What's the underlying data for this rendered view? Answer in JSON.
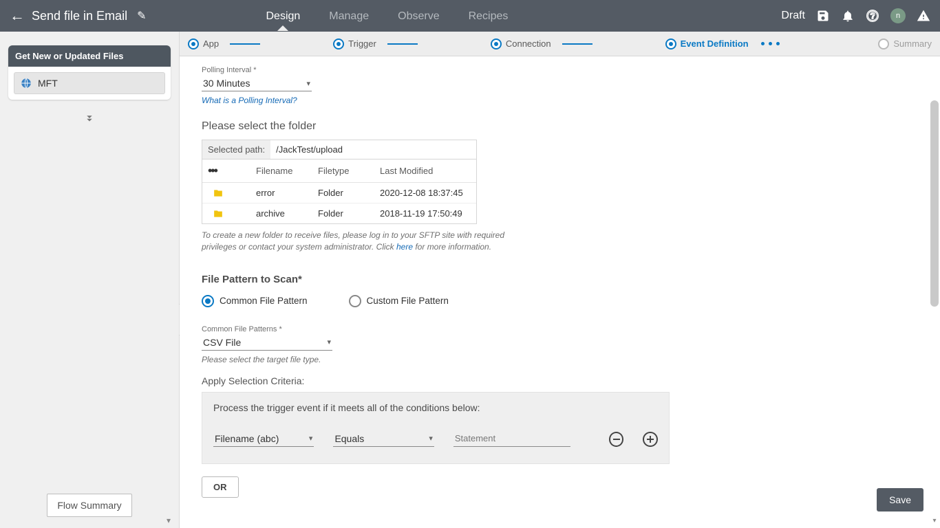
{
  "header": {
    "title": "Send file in Email",
    "tabs": [
      "Design",
      "Manage",
      "Observe",
      "Recipes"
    ],
    "active_tab": "Design",
    "status": "Draft",
    "avatar_letter": "n"
  },
  "sidebar": {
    "panel_title": "Get New or Updated Files",
    "item_label": "MFT",
    "flow_summary": "Flow Summary"
  },
  "stepper": {
    "steps": [
      "App",
      "Trigger",
      "Connection",
      "Event Definition",
      "Summary"
    ]
  },
  "polling": {
    "label": "Polling Interval *",
    "value": "30 Minutes",
    "help": "What is a Polling Interval?"
  },
  "folder": {
    "title": "Please select the folder",
    "selected_label": "Selected path:",
    "selected_path": "/JackTest/upload",
    "cols": [
      "Filename",
      "Filetype",
      "Last Modified"
    ],
    "rows": [
      {
        "name": "error",
        "type": "Folder",
        "modified": "2020-12-08 18:37:45"
      },
      {
        "name": "archive",
        "type": "Folder",
        "modified": "2018-11-19 17:50:49"
      }
    ],
    "hint_a": "To create a new folder to receive files, please log in to your SFTP site with required privileges or contact your system administrator. Click ",
    "hint_link": "here",
    "hint_b": " for more information."
  },
  "pattern": {
    "header": "File Pattern to Scan*",
    "opt_common": "Common File Pattern",
    "opt_custom": "Custom File Pattern",
    "common_label": "Common File Patterns *",
    "common_value": "CSV File",
    "common_help": "Please select the target file type."
  },
  "criteria": {
    "apply_label": "Apply Selection Criteria:",
    "box_text": "Process the trigger event if it meets all of the conditions below:",
    "field_value": "Filename  (abc)",
    "op_value": "Equals",
    "stmt_placeholder": "Statement",
    "or_label": "OR"
  },
  "save_label": "Save"
}
